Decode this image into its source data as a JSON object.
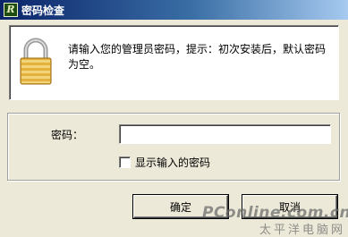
{
  "window": {
    "title": "密码检查",
    "app_icon_glyph": "R"
  },
  "message": {
    "icon": "padlock-icon",
    "text": "请输入您的管理员密码，提示：初次安装后，默认密码为空。"
  },
  "form": {
    "password_label": "密码：",
    "password_value": "",
    "show_password_label": "显示输入的密码",
    "show_password_checked": false
  },
  "buttons": {
    "ok_label": "确定",
    "cancel_label": "取消"
  },
  "watermark": {
    "line1": "PConline.com.cn",
    "line2": "太平洋电脑网"
  },
  "colors": {
    "titlebar_start": "#0a246a",
    "titlebar_end": "#a6caf0",
    "dialog_bg": "#ece9d8",
    "lock_gold": "#e3b23c"
  }
}
